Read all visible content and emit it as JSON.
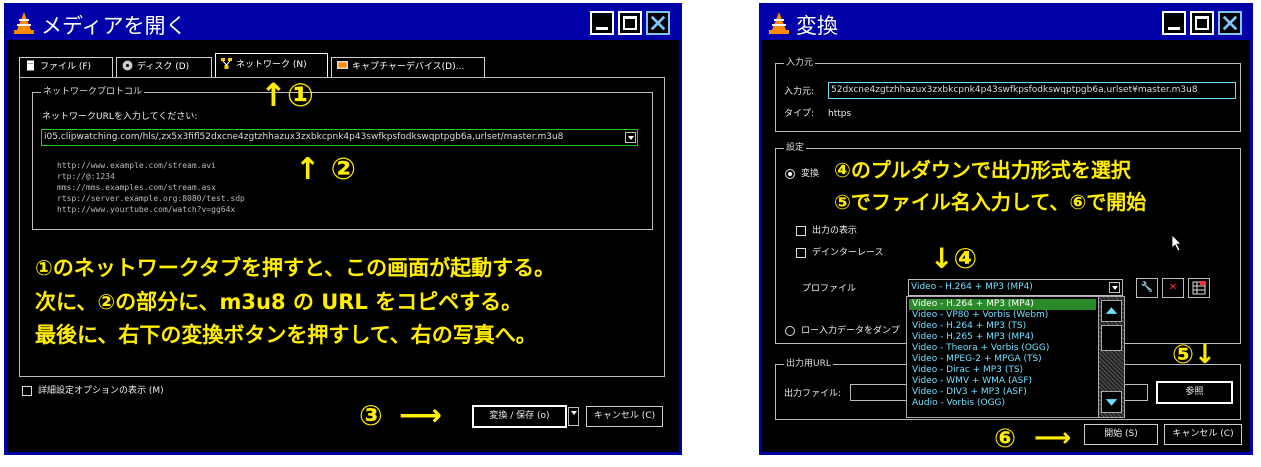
{
  "left_window": {
    "title": "メディアを開く",
    "tabs": [
      {
        "label": "ファイル (F)"
      },
      {
        "label": "ディスク (D)"
      },
      {
        "label": "ネットワーク (N)"
      },
      {
        "label": "キャプチャーデバイス(D)..."
      }
    ],
    "network_protocol": {
      "legend": "ネットワークプロトコル",
      "prompt": "ネットワークURLを入力してください:",
      "url_value": "i05.clipwatching.com/hls/,zx5x3fifl52dxcne4zgtzhhazux3zxbkcpnk4p43swfkpsfodkswqptpgb6a,urlset/master.m3u8",
      "examples": [
        "http://www.example.com/stream.avi",
        "rtp://@:1234",
        "mms://mms.examples.com/stream.asx",
        "rtsp://server.example.org:8080/test.sdp",
        "http://www.yourtube.com/watch?v=gg64x"
      ]
    },
    "annotations": {
      "circle1": "↑①",
      "circle2": "↑ ②",
      "circle3": "③",
      "arrow": "⟶",
      "instructions": [
        "①のネットワークタブを押すと、この画面が起動する。",
        "次に、②の部分に、m3u8 の URL をコピペする。",
        "最後に、右下の変換ボタンを押すして、右の写真へ。"
      ]
    },
    "advanced_options_label": "詳細設定オプションの表示 (M)",
    "convert_save_label": "変換 / 保存 (o)",
    "cancel_label": "キャンセル (C)"
  },
  "right_window": {
    "title": "変換",
    "source": {
      "legend": "入力元",
      "source_label": "入力元:",
      "source_value": "52dxcne4zgtzhhazux3zxbkcpnk4p43swfkpsfodkswqptpgb6a,urlset¥master.m3u8",
      "type_label": "タイプ:",
      "type_value": "https"
    },
    "settings": {
      "legend": "設定",
      "convert_label": "変換",
      "show_output_label": "出力の表示",
      "deinterlace_label": "デインターレース",
      "profile_label": "プロファイル",
      "profile_value": "Video - H.264 + MP3 (MP4)",
      "raw_dump_label": "ロー入力データをダンプ",
      "profile_options": [
        "Video - H.264 + MP3 (MP4)",
        "Video - VP80 + Vorbis (Webm)",
        "Video - H.264 + MP3 (TS)",
        "Video - H.265 + MP3 (MP4)",
        "Video - Theora + Vorbis (OGG)",
        "Video - MPEG-2 + MPGA (TS)",
        "Video - Dirac + MP3 (TS)",
        "Video - WMV + WMA (ASF)",
        "Video - DIV3 + MP3 (ASF)",
        "Audio - Vorbis (OGG)"
      ]
    },
    "output": {
      "legend": "出力用URL",
      "file_label": "出力ファイル:",
      "browse_label": "参照"
    },
    "start_label": "開始 (S)",
    "cancel_label": "キャンセル (C)",
    "annotations": {
      "line1": "④のプルダウンで出力形式を選択",
      "line2": "⑤でファイル名入力して、⑥で開始",
      "circle4": "↓④",
      "circle5": "⑤↓",
      "circle6": "⑥",
      "arrow": "⟶"
    }
  }
}
